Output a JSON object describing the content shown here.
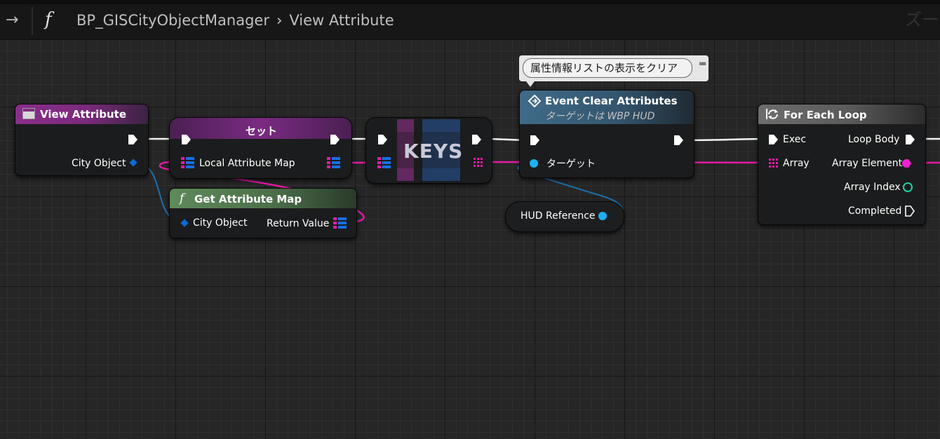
{
  "toolbar": {
    "back_icon": "→",
    "function_icon": "f",
    "breadcrumb_root": "BP_GISCityObjectManager",
    "breadcrumb_sep": "›",
    "breadcrumb_current": "View Attribute",
    "zoom_label": "ズー"
  },
  "comment": {
    "text": "属性情報リストの表示をクリア",
    "pin_icon": "pin-icon"
  },
  "nodes": {
    "view_attribute": {
      "title": "View Attribute",
      "pin_city_object": "City Object"
    },
    "set": {
      "title": "セット",
      "pin_local_attribute_map": "Local Attribute Map"
    },
    "keys": {
      "title": "KEYS"
    },
    "get_attribute_map": {
      "title": "Get Attribute Map",
      "pin_city_object": "City Object",
      "pin_return_value": "Return Value"
    },
    "event_clear_attributes": {
      "title": "Event Clear Attributes",
      "subtitle": "ターゲットは WBP HUD",
      "pin_target": "ターゲット"
    },
    "hud_reference": {
      "title": "HUD Reference"
    },
    "for_each_loop": {
      "title": "For Each Loop",
      "pin_exec": "Exec",
      "pin_array": "Array",
      "pin_loop_body": "Loop Body",
      "pin_array_element": "Array Element",
      "pin_array_index": "Array Index",
      "pin_completed": "Completed"
    }
  },
  "colors": {
    "exec_wire": "#ffffff",
    "map_wire": "#e51aa6",
    "object_wire": "#1f7dbd",
    "struct_pin": "#0b5fd4",
    "index_pin": "#1ed1a3"
  }
}
